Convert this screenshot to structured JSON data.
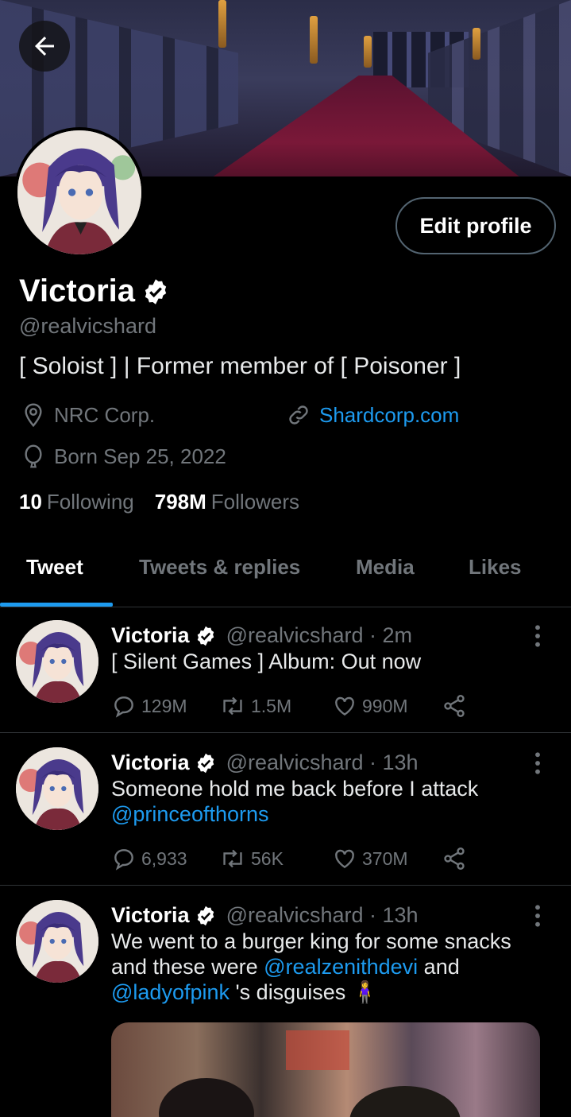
{
  "profile": {
    "name": "Victoria",
    "handle": "@realvicshard",
    "bio": "[ Soloist ] | Former member of [ Poisoner ]",
    "location": "NRC Corp.",
    "website": "Shardcorp.com",
    "birthday": "Born Sep 25, 2022",
    "following_count": "10",
    "following_label": "Following",
    "followers_count": "798M",
    "followers_label": "Followers",
    "edit_button": "Edit profile"
  },
  "tabs": [
    {
      "label": "Tweet",
      "active": true
    },
    {
      "label": "Tweets & replies",
      "active": false
    },
    {
      "label": "Media",
      "active": false
    },
    {
      "label": "Likes",
      "active": false
    }
  ],
  "tweets": [
    {
      "name": "Victoria",
      "handle_time": "@realvicshard · 2m",
      "text": "[ Silent Games ] Album: Out now",
      "replies": "129M",
      "retweets": "1.5M",
      "likes": "990M"
    },
    {
      "name": "Victoria",
      "handle_time": "@realvicshard · 13h",
      "text": "Someone hold me back before I attack",
      "mention": "@princeofthorns",
      "replies": "6,933",
      "retweets": "56K",
      "likes": "370M"
    },
    {
      "name": "Victoria",
      "handle_time": "@realvicshard · 13h",
      "text_1": "We went to a burger king for some snacks",
      "text_2": "and these were",
      "mention_1": "@realzenithdevi",
      "text_3": "and",
      "mention_2": "@ladyofpink",
      "text_4": "'s disguises",
      "emoji": "🧍‍♀️"
    }
  ],
  "colors": {
    "accent": "#1d9bf0",
    "muted": "#71767b",
    "background": "#000000"
  },
  "icons": [
    "back-arrow-icon",
    "verified-badge-icon",
    "location-icon",
    "link-icon",
    "birthday-icon",
    "reply-icon",
    "retweet-icon",
    "like-icon",
    "share-icon",
    "more-icon"
  ]
}
